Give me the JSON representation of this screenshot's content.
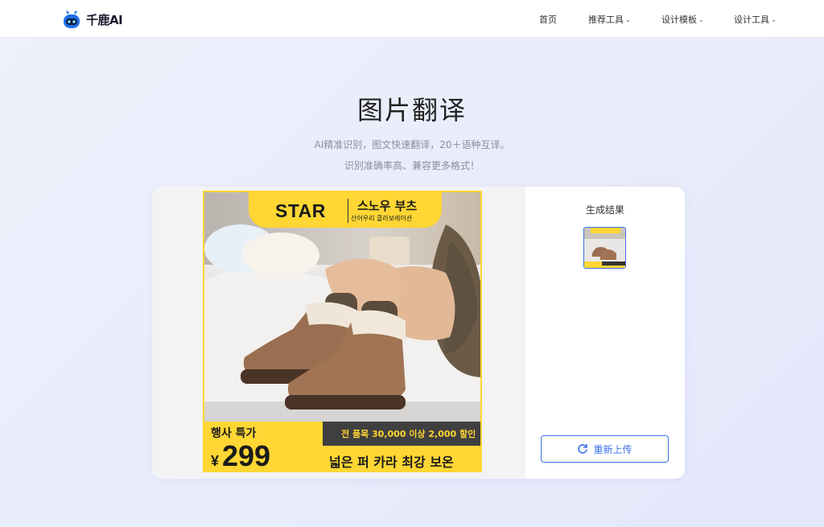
{
  "header": {
    "logo_text": "千鹿AI",
    "nav": [
      {
        "label": "首页",
        "has_dropdown": false
      },
      {
        "label": "推荐工具",
        "has_dropdown": true
      },
      {
        "label": "设计模板",
        "has_dropdown": true
      },
      {
        "label": "设计工具",
        "has_dropdown": true
      }
    ]
  },
  "hero": {
    "title": "图片翻译",
    "subtitle_line1": "AI精准识别，图文快速翻译，20＋语种互译。",
    "subtitle_line2": "识别准确率高、兼容更多格式！"
  },
  "preview": {
    "ad": {
      "brand": "STAR",
      "product": "스노우 부츠",
      "collab": "산어우리 콜라보레이션",
      "event_label": "행사 특가",
      "currency": "¥",
      "price": "299",
      "coupon": "전 품목 30,000 이상 2,000 할인",
      "tagline": "넓은 퍼 카라 최강 보온"
    }
  },
  "result": {
    "title": "生成结果",
    "reupload_label": "重新上传"
  },
  "colors": {
    "accent": "#3b6fe8",
    "ad_yellow": "#ffd633"
  }
}
